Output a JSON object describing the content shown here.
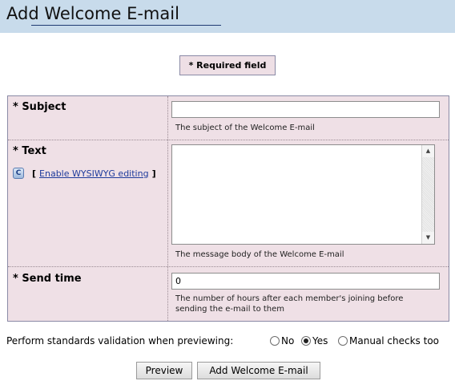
{
  "header": {
    "title": "Add Welcome E-mail"
  },
  "required_notice": "* Required field",
  "fields": {
    "subject": {
      "label": "* Subject",
      "value": "",
      "help": "The subject of the Welcome E-mail"
    },
    "text": {
      "label": "* Text",
      "value": "",
      "wysiwyg_open": "[",
      "wysiwyg_link": "Enable WYSIWYG editing",
      "wysiwyg_close": "]",
      "help": "The message body of the Welcome E-mail",
      "scroll_up_glyph": "▲",
      "scroll_down_glyph": "▼"
    },
    "send_time": {
      "label": "* Send time",
      "value": "0",
      "help_line1": "The number of hours after each member's joining before",
      "help_line2": "sending the e-mail to them"
    }
  },
  "validation": {
    "label": "Perform standards validation when previewing:",
    "options": [
      "No",
      "Yes",
      "Manual checks too"
    ],
    "selected": "Yes"
  },
  "buttons": {
    "preview": "Preview",
    "submit": "Add Welcome E-mail"
  },
  "colors": {
    "header_bg": "#c8dbeb",
    "form_bg": "#efe0e6",
    "link": "#1f3b9c"
  },
  "icons": {
    "wysiwyg_icon": "c-icon"
  }
}
